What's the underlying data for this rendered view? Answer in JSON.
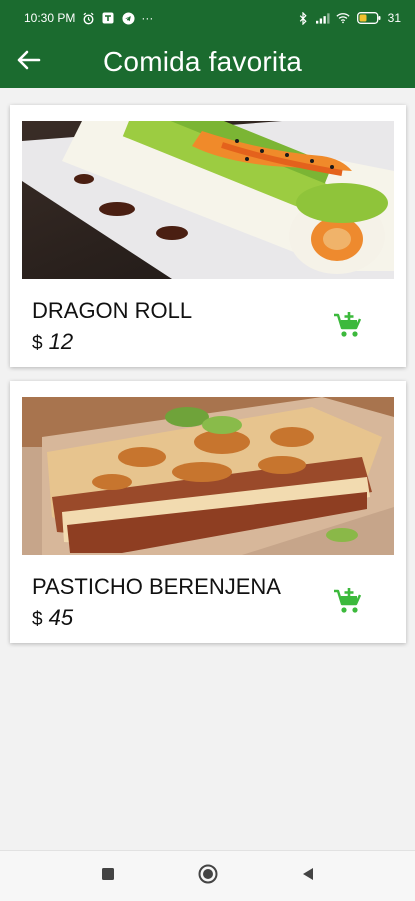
{
  "status_bar": {
    "time": "10:30 PM",
    "left_icons": [
      "alarm-icon",
      "app-notification-icon",
      "telegram-icon",
      "more-dots-icon"
    ],
    "more": "···",
    "right_icons": [
      "bluetooth-icon",
      "signal-icon",
      "wifi-icon",
      "battery-icon"
    ],
    "battery": "31"
  },
  "app_bar": {
    "back_icon": "arrow-back-icon",
    "title": "Comida favorita",
    "color": "#1b6b2f"
  },
  "items": [
    {
      "name": "DRAGON ROLL",
      "currency": "$",
      "price": "12",
      "image": "sushi-dragon-roll-photo",
      "cart_icon": "add-shopping-cart-icon"
    },
    {
      "name": "PASTICHO BERENJENA",
      "currency": "$",
      "price": "45",
      "image": "lasagna-photo",
      "cart_icon": "add-shopping-cart-icon"
    }
  ],
  "accent_green": "#3cb93c",
  "nav_bar": {
    "icons": [
      "recents-square-icon",
      "home-circle-icon",
      "back-triangle-icon"
    ]
  }
}
